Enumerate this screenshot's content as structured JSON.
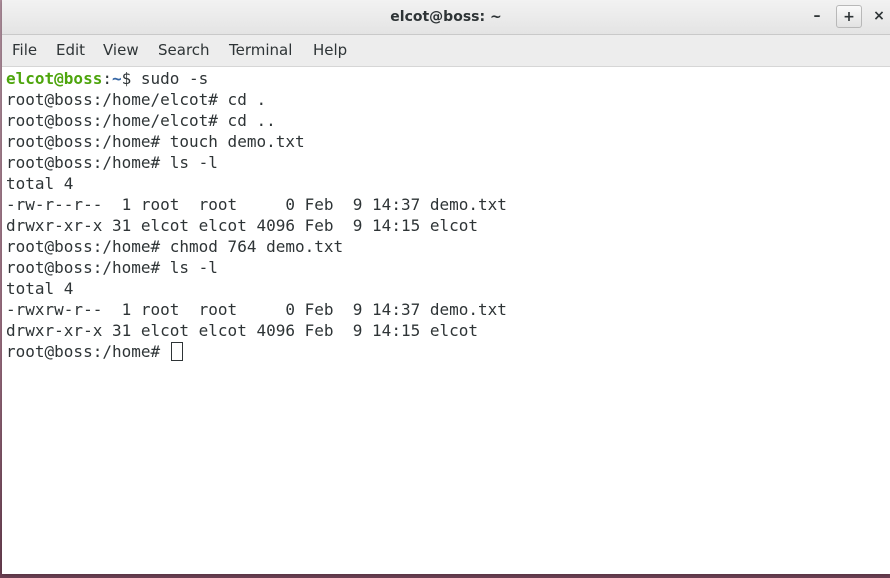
{
  "window": {
    "title": "elcot@boss: ~",
    "controls": {
      "minimize": "–",
      "maximize": "+",
      "close": "×"
    }
  },
  "menubar": {
    "items": [
      "File",
      "Edit",
      "View",
      "Search",
      "Terminal",
      "Help"
    ]
  },
  "terminal": {
    "first_prompt": {
      "user": "elcot@boss",
      "sep": ":",
      "path": "~",
      "symbol": "$",
      "command": " sudo -s"
    },
    "lines": [
      "root@boss:/home/elcot# cd .",
      "root@boss:/home/elcot# cd ..",
      "root@boss:/home# touch demo.txt",
      "root@boss:/home# ls -l",
      "total 4",
      "-rw-r--r--  1 root  root     0 Feb  9 14:37 demo.txt",
      "drwxr-xr-x 31 elcot elcot 4096 Feb  9 14:15 elcot",
      "root@boss:/home# chmod 764 demo.txt",
      "root@boss:/home# ls -l",
      "total 4",
      "-rwxrw-r--  1 root  root     0 Feb  9 14:37 demo.txt",
      "drwxr-xr-x 31 elcot elcot 4096 Feb  9 14:15 elcot"
    ],
    "last_prompt": "root@boss:/home# "
  },
  "colors": {
    "prompt_user": "#4ea50d",
    "prompt_path": "#3465a4",
    "text": "#2e3436",
    "background": "#ffffff"
  }
}
